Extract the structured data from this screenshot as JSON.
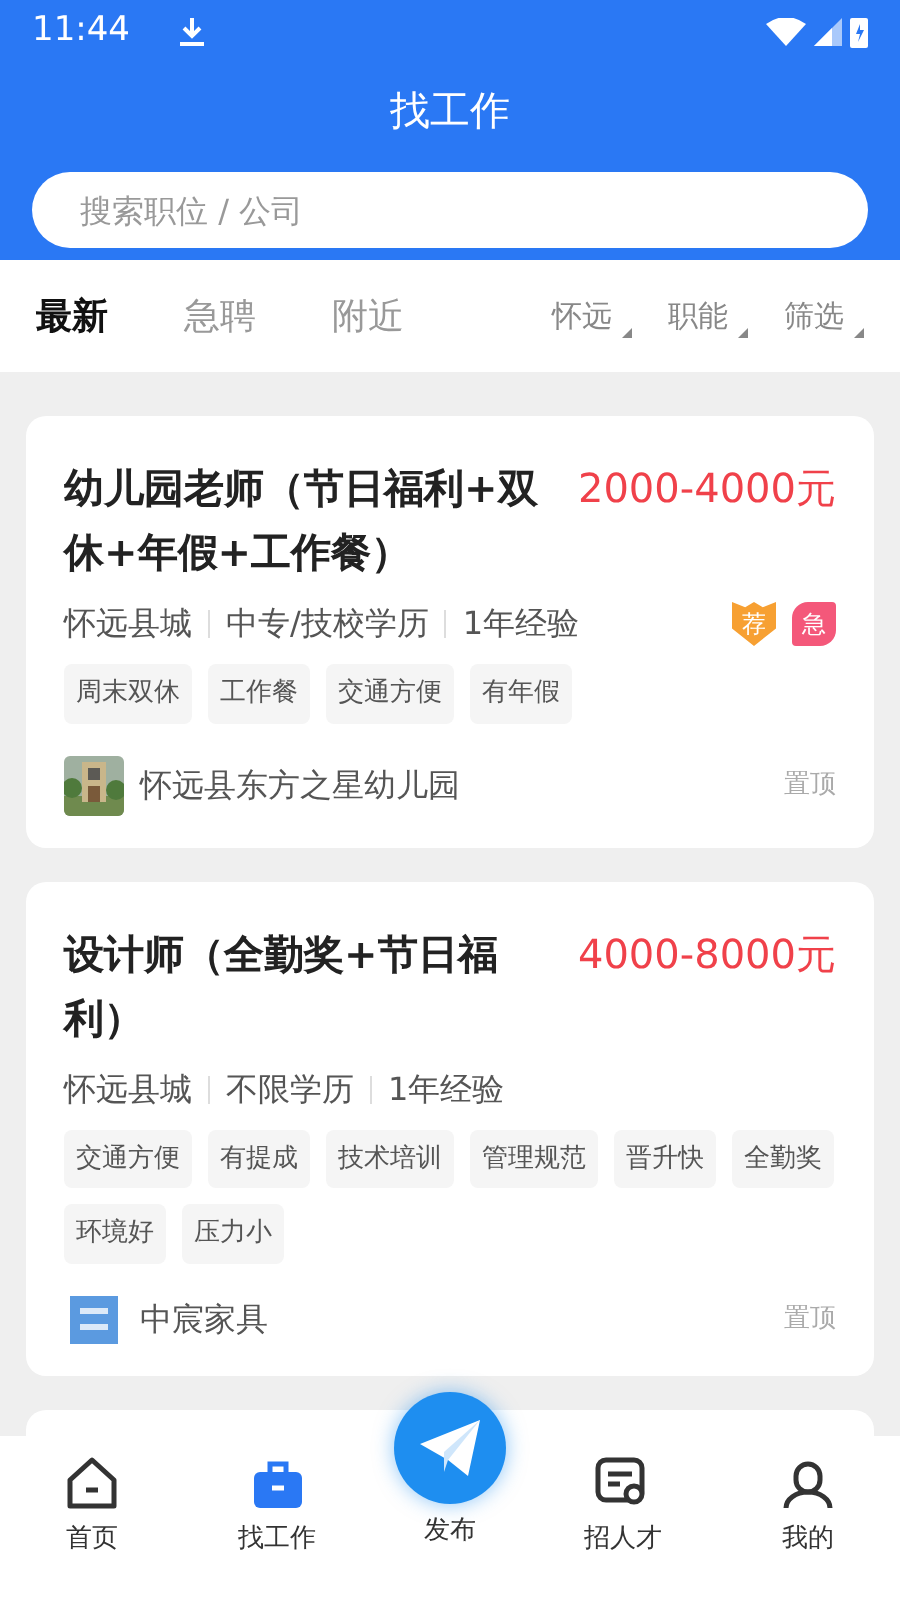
{
  "status_bar": {
    "time": "11:44"
  },
  "title": "找工作",
  "search": {
    "placeholder": "搜索职位 / 公司"
  },
  "tabs": [
    {
      "label": "最新",
      "selected": true
    },
    {
      "label": "急聘",
      "selected": false
    },
    {
      "label": "附近",
      "selected": false
    }
  ],
  "filters": [
    "怀远",
    "职能",
    "筛选"
  ],
  "jobs": [
    {
      "title": "幼儿园老师（节日福利+双休+年假+工作餐）",
      "salary": "2000-4000元",
      "meta": [
        "怀远县城",
        "中专/技校学历",
        "1年经验"
      ],
      "badges": [
        {
          "text": "荐",
          "kind": "recommend"
        },
        {
          "text": "急",
          "kind": "urgent"
        }
      ],
      "tags": [
        "周末双休",
        "工作餐",
        "交通方便",
        "有年假"
      ],
      "company": "怀远县东方之星幼儿园",
      "logo": {
        "kind": "picture"
      },
      "action": "置顶"
    },
    {
      "title": "设计师（全勤奖+节日福利）",
      "salary": "4000-8000元",
      "meta": [
        "怀远县城",
        "不限学历",
        "1年经验"
      ],
      "tags": [
        "交通方便",
        "有提成",
        "技术培训",
        "管理规范",
        "晋升快",
        "全勤奖",
        "环境好",
        "压力小"
      ],
      "company": "中宸家具",
      "logo": {
        "kind": "mark"
      },
      "action": "置顶"
    }
  ],
  "nav": [
    {
      "label": "首页",
      "kind": "home",
      "selected": false
    },
    {
      "label": "找工作",
      "kind": "jobs",
      "selected": true
    },
    {
      "label": "发布",
      "kind": "publish"
    },
    {
      "label": "招人才",
      "kind": "talent",
      "selected": false
    },
    {
      "label": "我的",
      "kind": "profile",
      "selected": false
    }
  ]
}
